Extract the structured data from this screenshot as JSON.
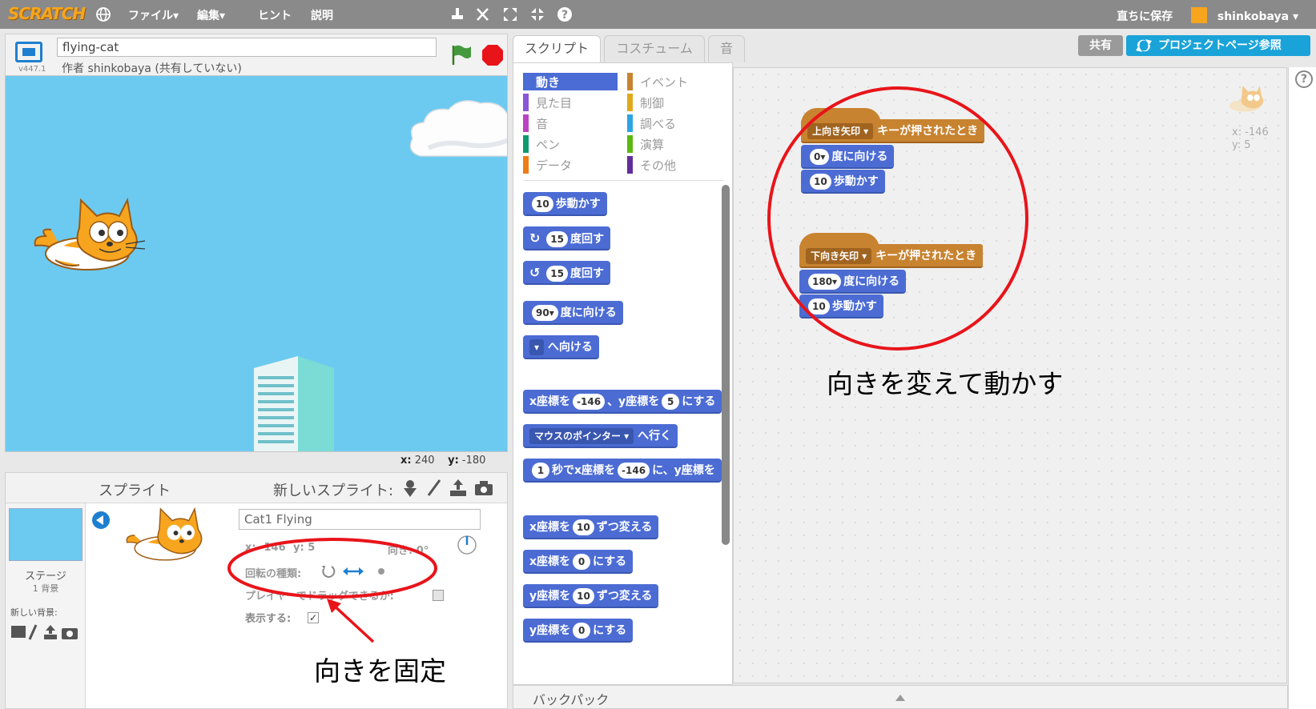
{
  "menubar": {
    "logo": "SCRATCH",
    "items": [
      "ファイル▾",
      "編集▾",
      "ヒント",
      "説明"
    ],
    "save_now": "直ちに保存",
    "username": "shinkobaya ▾"
  },
  "stage": {
    "project_title": "flying-cat",
    "version": "v447.1",
    "author": "作者 shinkobaya (共有していない)",
    "coords_x_label": "x:",
    "coords_x": "240",
    "coords_y_label": "y:",
    "coords_y": "-180"
  },
  "sprites_panel": {
    "title": "スプライト",
    "new_sprite_label": "新しいスプライト:",
    "stage_label": "ステージ",
    "stage_sub": "1 背景",
    "new_backdrop_label": "新しい背景:",
    "sprite_name": "Cat1 Flying",
    "x_label": "x: -146",
    "y_label": "y: 5",
    "direction_label": "向き: 0°",
    "rotation_style_label": "回転の種類:",
    "draggable_label": "プレイヤーでドラッグできるか:",
    "show_label": "表示する:"
  },
  "tabs": [
    "スクリプト",
    "コスチューム",
    "音"
  ],
  "categories": {
    "left": [
      "動き",
      "見た目",
      "音",
      "ペン",
      "データ"
    ],
    "right": [
      "イベント",
      "制御",
      "調べる",
      "演算",
      "その他"
    ],
    "colors_left": [
      "#4a6cd4",
      "#8a55d7",
      "#bb42c3",
      "#0e9a6c",
      "#ee7d16"
    ],
    "colors_right": [
      "#c88330",
      "#e1a91a",
      "#2ca5e2",
      "#5cb712",
      "#632d99"
    ]
  },
  "palette_blocks": {
    "move": {
      "num": "10",
      "text": "歩動かす"
    },
    "turn_right": {
      "num": "15",
      "text": "度回す"
    },
    "turn_left": {
      "num": "15",
      "text": "度回す"
    },
    "point_dir": {
      "num": "90▾",
      "text": "度に向ける"
    },
    "point_towards": {
      "dd": "▾",
      "text": "へ向ける"
    },
    "goto_xy": {
      "a": "x座標を",
      "x": "-146",
      "b": "、y座標を",
      "y": "5",
      "c": "にする"
    },
    "goto": {
      "dd": "マウスのポインター ▾",
      "text": "へ行く"
    },
    "glide": {
      "secs": "1",
      "a": "秒でx座標を",
      "x": "-146",
      "b": "に、y座標を"
    },
    "change_x": {
      "a": "x座標を",
      "n": "10",
      "b": "ずつ変える"
    },
    "set_x": {
      "a": "x座標を",
      "n": "0",
      "b": "にする"
    },
    "change_y": {
      "a": "y座標を",
      "n": "10",
      "b": "ずつ変える"
    },
    "set_y": {
      "a": "y座標を",
      "n": "0",
      "b": "にする"
    }
  },
  "script_area": {
    "share_button": "共有",
    "project_page_button": "プロジェクトページ参照",
    "help": "?",
    "sprite_x": "x: -146",
    "sprite_y": "y: 5",
    "zoom_out": "−",
    "zoom_reset": "=",
    "zoom_in": "+",
    "script1": {
      "key": "上向き矢印 ▾",
      "hat_text": "キーが押されたとき",
      "dir": "0▾",
      "dir_text": "度に向ける",
      "steps": "10",
      "steps_text": "歩動かす"
    },
    "script2": {
      "key": "下向き矢印 ▾",
      "hat_text": "キーが押されたとき",
      "dir": "180▾",
      "dir_text": "度に向ける",
      "steps": "10",
      "steps_text": "歩動かす"
    }
  },
  "backpack": {
    "label": "バックパック"
  },
  "annotations": {
    "script": "向きを変えて動かす",
    "rotation": "向きを固定"
  },
  "colors": {
    "motion": "#4c6cd4",
    "events": "#c88330",
    "annotation_red": "#e8141a",
    "stage_sky": "#6ccaf0"
  }
}
